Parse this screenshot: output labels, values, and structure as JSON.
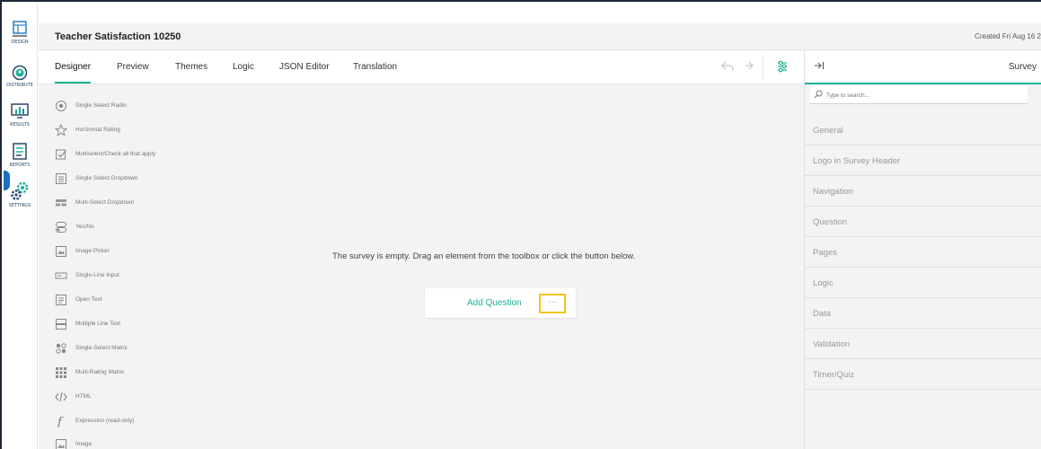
{
  "rail": {
    "items": [
      {
        "label": "DESIGN",
        "icon": "design-icon"
      },
      {
        "label": "DISTRIBUTE",
        "icon": "distribute-icon"
      },
      {
        "label": "RESULTS",
        "icon": "results-icon"
      },
      {
        "label": "REPORTS",
        "icon": "reports-icon"
      },
      {
        "label": "SETTINGS",
        "icon": "settings-icon"
      }
    ]
  },
  "header": {
    "title": "Teacher Satisfaction 10250",
    "created": "Created Fri Aug 16 2"
  },
  "tabs": [
    {
      "label": "Designer"
    },
    {
      "label": "Preview"
    },
    {
      "label": "Themes"
    },
    {
      "label": "Logic"
    },
    {
      "label": "JSON Editor"
    },
    {
      "label": "Translation"
    }
  ],
  "toolbox": {
    "items": [
      {
        "label": "Single Select Radio",
        "icon": "radio-icon"
      },
      {
        "label": "Horizontal Rating",
        "icon": "star-icon"
      },
      {
        "label": "Multiselect/Check all that apply",
        "icon": "checkbox-icon"
      },
      {
        "label": "Single Select Dropdown",
        "icon": "dropdown-icon"
      },
      {
        "label": "Multi-Select Dropdown",
        "icon": "multi-dropdown-icon"
      },
      {
        "label": "Yes/No",
        "icon": "toggle-icon"
      },
      {
        "label": "Image Picker",
        "icon": "image-picker-icon"
      },
      {
        "label": "Single-Line Input",
        "icon": "text-input-icon"
      },
      {
        "label": "Open Text",
        "icon": "open-text-icon"
      },
      {
        "label": "Multiple Line Text",
        "icon": "multi-line-text-icon"
      },
      {
        "label": "Single-Select Matrix",
        "icon": "matrix-icon"
      },
      {
        "label": "Multi-Rating Matrix",
        "icon": "rating-matrix-icon"
      },
      {
        "label": "HTML",
        "icon": "html-icon"
      },
      {
        "label": "Expression (read-only)",
        "icon": "expression-icon"
      },
      {
        "label": "Image",
        "icon": "image-icon"
      }
    ]
  },
  "canvas": {
    "empty_message": "The survey is empty. Drag an element from the toolbox or click the button below.",
    "add_question": "Add Question",
    "more": "···"
  },
  "right_panel": {
    "title": "Survey",
    "collapse": "→|",
    "search_placeholder": "Type to search...",
    "sections": [
      "General",
      "Logo in Survey Header",
      "Navigation",
      "Question",
      "Pages",
      "Logic",
      "Data",
      "Validation",
      "Timer/Quiz"
    ]
  },
  "colors": {
    "accent": "#19b394",
    "highlight": "#f5c518",
    "rail_active": "#1a6fc0"
  }
}
